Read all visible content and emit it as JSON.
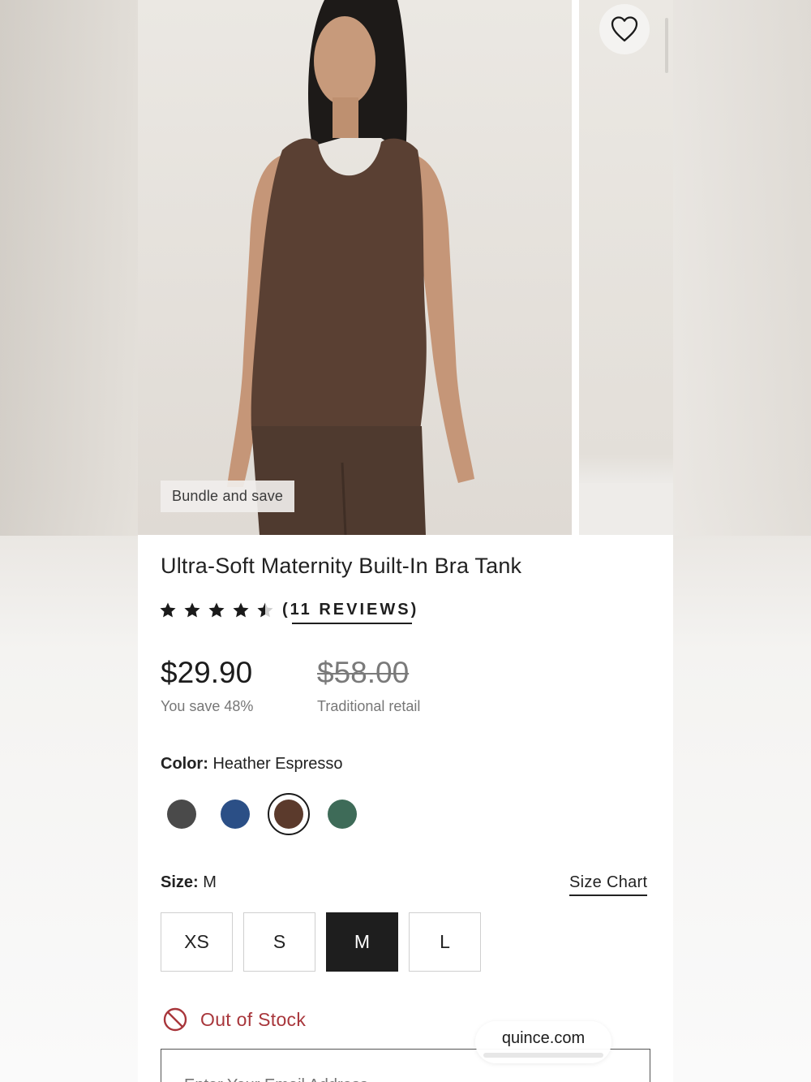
{
  "gallery": {
    "badge": "Bundle and save",
    "favorite_icon": "heart-outline-icon"
  },
  "product": {
    "title": "Ultra-Soft Maternity Built-In Bra Tank",
    "rating": 4.5,
    "rating_max": 5,
    "reviews_label": "(11 REVIEWS)"
  },
  "price": {
    "current": "$29.90",
    "savings": "You save 48%",
    "original": "$58.00",
    "original_label": "Traditional retail"
  },
  "color": {
    "label": "Color:",
    "value": "Heather Espresso",
    "swatches": [
      {
        "name": "charcoal",
        "hex": "#4a4a4a",
        "selected": false
      },
      {
        "name": "navy",
        "hex": "#2b4f86",
        "selected": false
      },
      {
        "name": "espresso",
        "hex": "#5b3a2c",
        "selected": true
      },
      {
        "name": "green",
        "hex": "#3e6b58",
        "selected": false
      }
    ]
  },
  "size": {
    "label": "Size:",
    "value": "M",
    "chart_link": "Size Chart",
    "options": [
      "XS",
      "S",
      "M",
      "L"
    ],
    "selected": "M"
  },
  "stock": {
    "status": "Out of Stock",
    "icon": "prohibited-icon",
    "color": "#a8363b"
  },
  "email": {
    "placeholder": "Enter Your Email Address"
  },
  "browser": {
    "url": "quince.com"
  }
}
